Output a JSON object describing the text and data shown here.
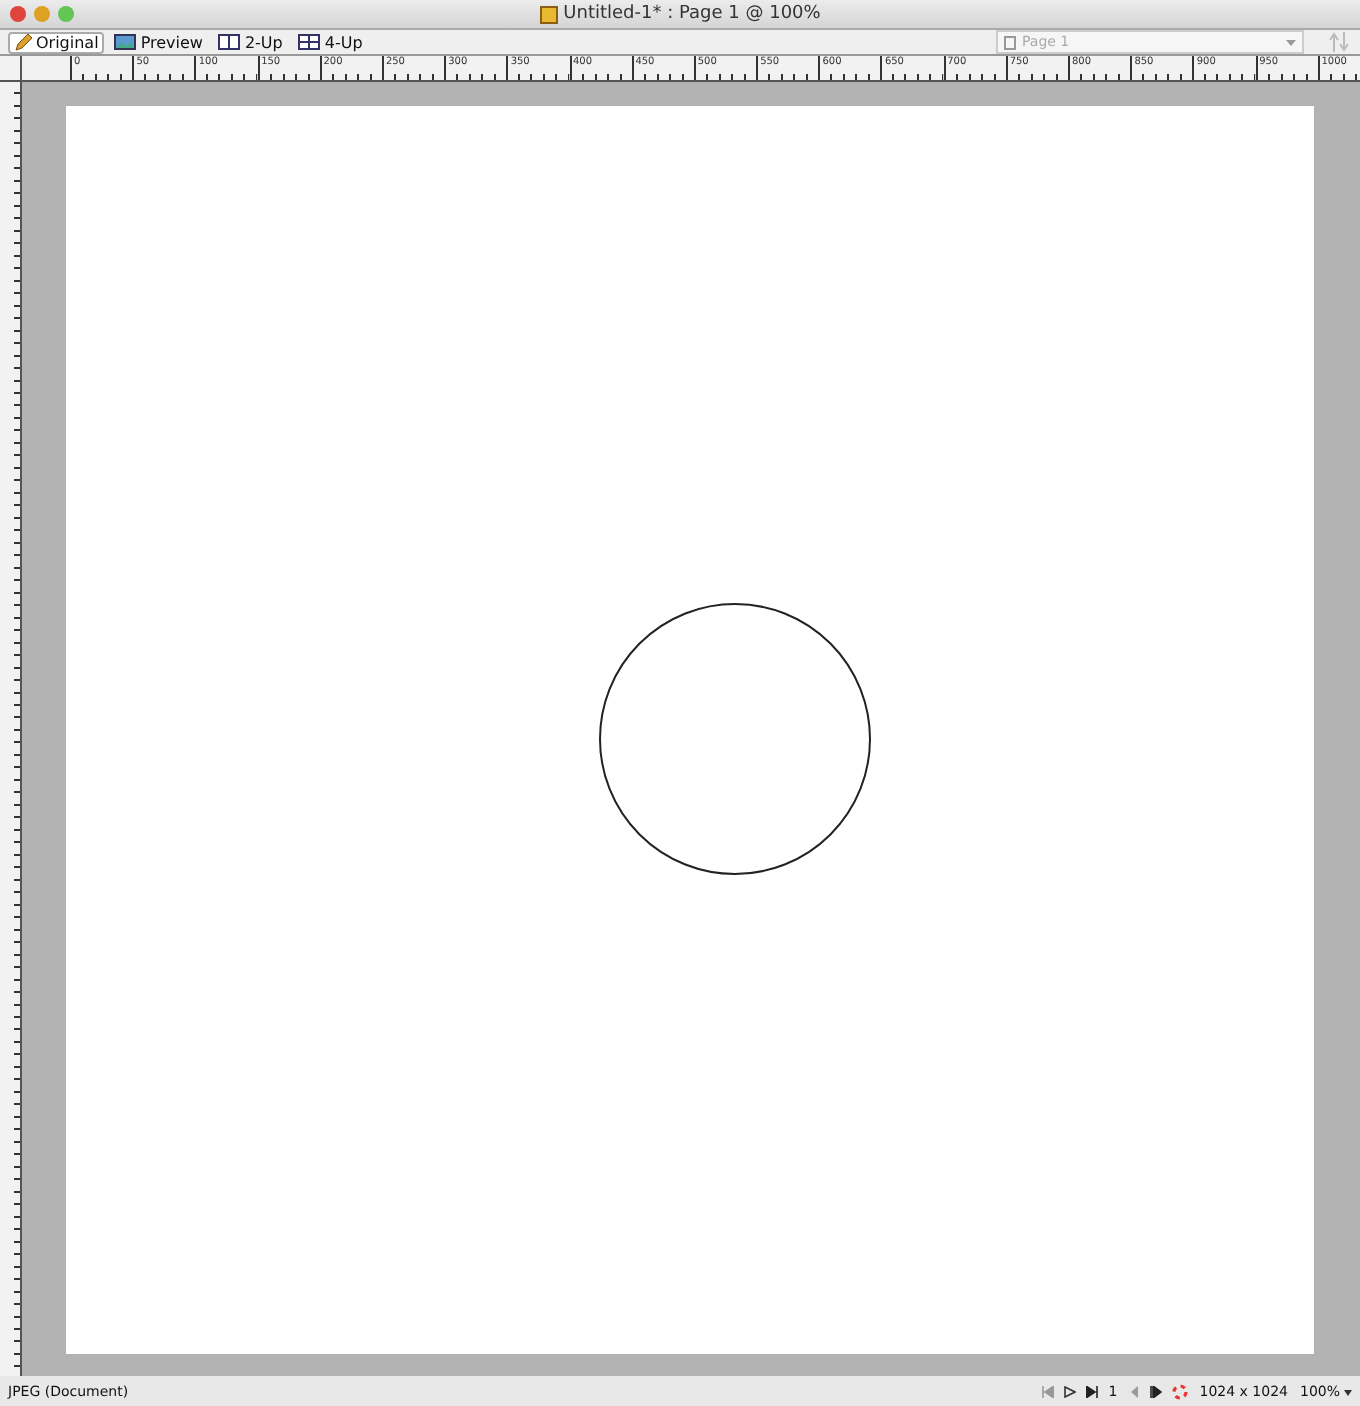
{
  "window": {
    "title": "Untitled-1* : Page 1 @ 100%"
  },
  "tabs": [
    {
      "label": "Original",
      "selected": true,
      "kind": "pencil"
    },
    {
      "label": "Preview",
      "selected": false,
      "kind": "image"
    },
    {
      "label": "2-Up",
      "selected": false,
      "kind": "two"
    },
    {
      "label": "4-Up",
      "selected": false,
      "kind": "four"
    }
  ],
  "page_select": {
    "value": "Page 1",
    "disabled": true
  },
  "ruler": {
    "labels": [
      "0",
      "50",
      "100",
      "150",
      "200",
      "250",
      "300",
      "350",
      "400",
      "450",
      "500",
      "550",
      "600",
      "650",
      "700",
      "750",
      "800",
      "850",
      "900",
      "950",
      "1000"
    ]
  },
  "status_bar": {
    "format": "JPEG (Document)",
    "frame": "1",
    "dimensions": "1024 x 1024",
    "zoom": "100%"
  }
}
